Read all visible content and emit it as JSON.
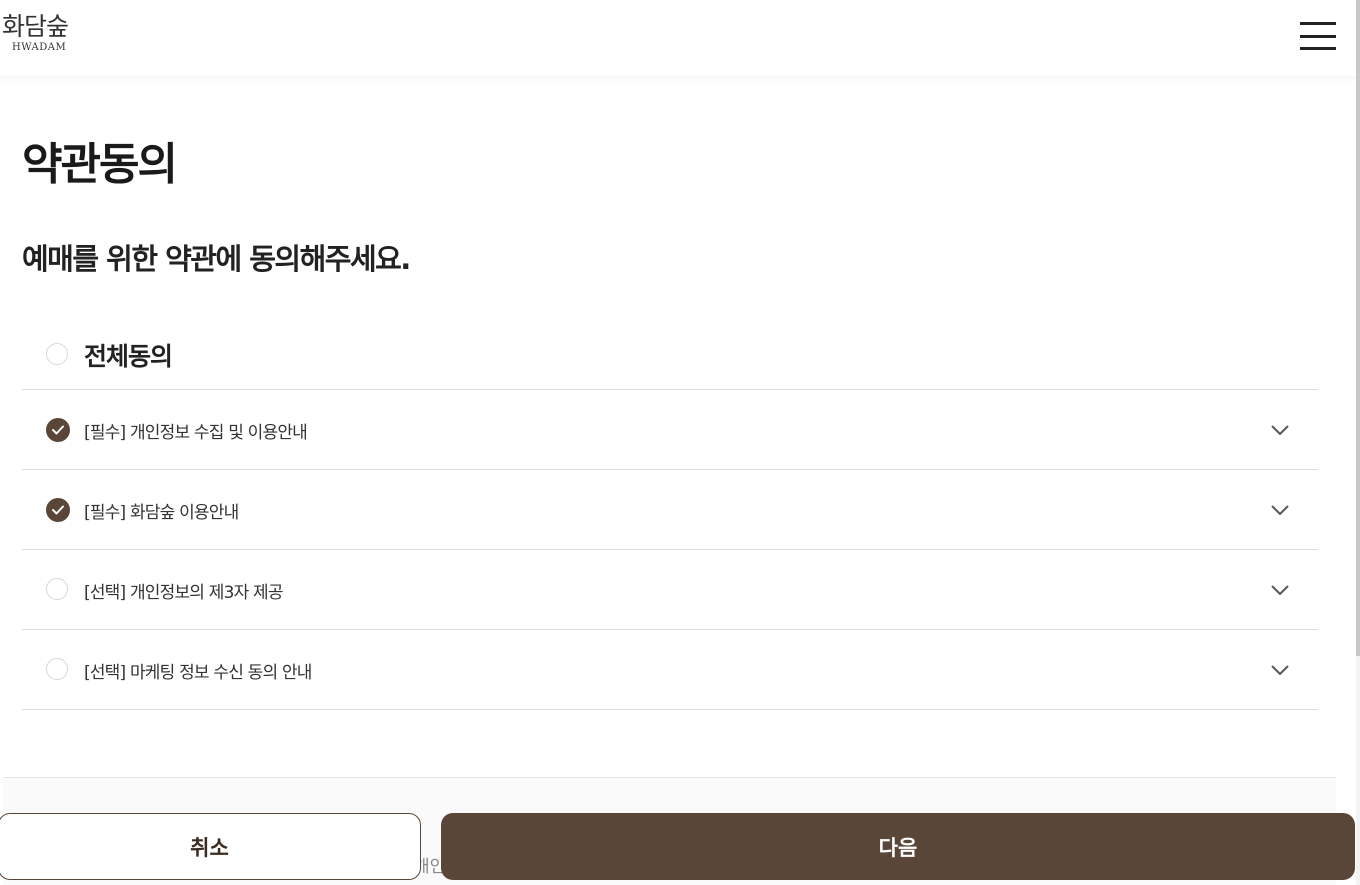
{
  "header": {
    "logo_ko": "화담숲",
    "logo_en": "HWADAM"
  },
  "page": {
    "title": "약관동의",
    "subtitle": "예매를 위한 약관에 동의해주세요."
  },
  "agreement": {
    "all_label": "전체동의",
    "all_checked": false,
    "items": [
      {
        "label": "[필수] 개인정보 수집 및 이용안내",
        "checked": true
      },
      {
        "label": "[필수] 화담숲 이용안내",
        "checked": true
      },
      {
        "label": "[선택] 개인정보의 제3자 제공",
        "checked": false
      },
      {
        "label": "[선택] 마케팅 정보 수신 동의 안내",
        "checked": false
      }
    ]
  },
  "footer": {
    "peek_text": "개인"
  },
  "buttons": {
    "cancel": "취소",
    "next": "다음"
  },
  "colors": {
    "brand": "#5a4638",
    "divider": "#dcdcdc"
  }
}
